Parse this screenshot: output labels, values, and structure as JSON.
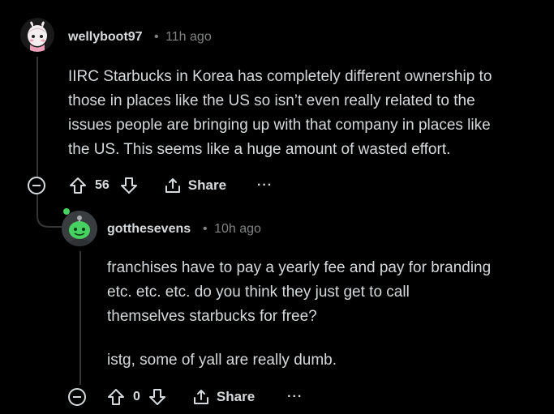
{
  "comments": [
    {
      "username": "wellyboot97",
      "separator": "•",
      "time": "11h ago",
      "body": [
        "IIRC Starbucks in Korea has completely different ownership to",
        "those in places like the US so isn’t even really related to the",
        "issues people are bringing up with that company in places like",
        "the US. This seems like a huge amount of wasted effort."
      ],
      "votes": "56",
      "share_label": "Share",
      "more_label": "···",
      "icons": [
        "collapse-icon",
        "upvote-icon",
        "downvote-icon",
        "share-icon",
        "more-icon"
      ]
    },
    {
      "username": "gotthesevens",
      "separator": "•",
      "time": "10h ago",
      "body": [
        "franchises have to pay a yearly fee and pay for branding",
        "etc. etc. etc. do you think they just get to call",
        "themselves starbucks for free?"
      ],
      "body2": "istg, some of yall are really dumb.",
      "votes": "0",
      "share_label": "Share",
      "more_label": "···",
      "icons": [
        "collapse-icon",
        "upvote-icon",
        "downvote-icon",
        "share-icon",
        "more-icon"
      ]
    }
  ],
  "colors": {
    "background": "#000000",
    "text": "#d7dadc",
    "meta": "#818384",
    "thread": "#343536",
    "avatar2_bg": "#3a3d40",
    "snoo_green": "#46d160"
  }
}
